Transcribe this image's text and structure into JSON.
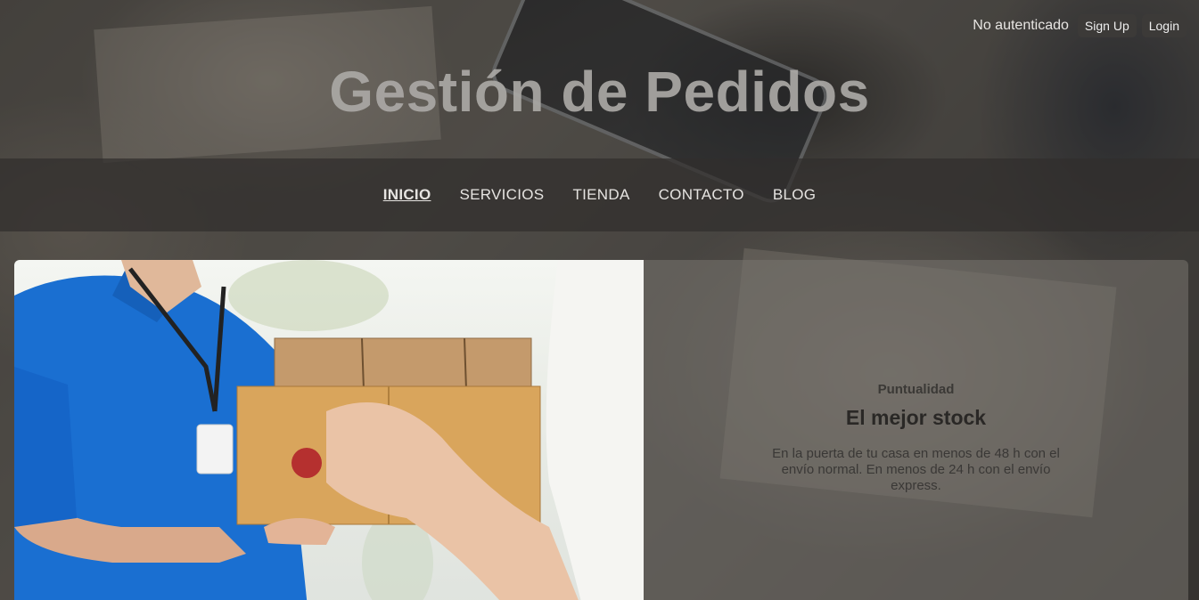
{
  "auth": {
    "status": "No autenticado",
    "signup_label": "Sign Up",
    "login_label": "Login"
  },
  "header": {
    "title": "Gestión de Pedidos"
  },
  "nav": {
    "items": [
      {
        "label": "INICIO",
        "active": true
      },
      {
        "label": "SERVICIOS",
        "active": false
      },
      {
        "label": "TIENDA",
        "active": false
      },
      {
        "label": "CONTACTO",
        "active": false
      },
      {
        "label": "BLOG",
        "active": false
      }
    ]
  },
  "feature": {
    "eyebrow": "Puntualidad",
    "title": "El mejor stock",
    "description": "En la puerta de tu casa en menos de 48 h con el envío normal. En menos de 24 h con el envío express."
  },
  "colors": {
    "nav_bg": "#302e2c",
    "courier_shirt": "#1a6fd1",
    "parcel": "#d9a55c"
  }
}
